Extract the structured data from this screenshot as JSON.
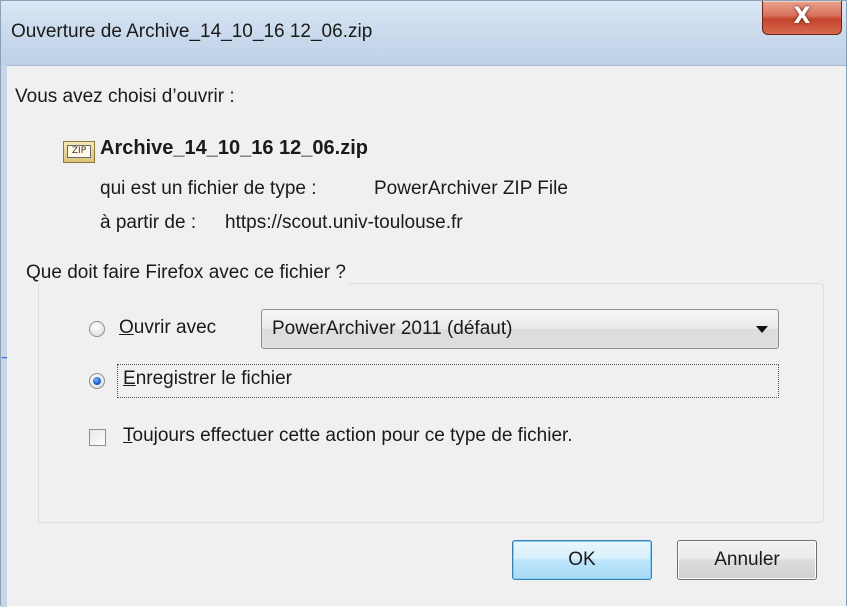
{
  "window": {
    "title": "Ouverture de Archive_14_10_16 12_06.zip",
    "close_label": "X"
  },
  "intro": "Vous avez choisi d’ouvrir :",
  "file": {
    "icon_label": "ZIP",
    "name": "Archive_14_10_16 12_06.zip",
    "type_label": "qui est un fichier de type :",
    "type_value": "PowerArchiver ZIP File",
    "source_label": "à partir de :",
    "source_value": "https://scout.univ-toulouse.fr"
  },
  "group": {
    "title": "Que doit faire Firefox avec ce fichier ?",
    "open_with": {
      "access_key": "O",
      "label_rest": "uvrir avec",
      "checked": false,
      "app": "PowerArchiver 2011 (défaut)"
    },
    "save": {
      "access_key": "E",
      "label_rest": "nregistrer le fichier",
      "checked": true
    },
    "always": {
      "access_key": "T",
      "label_rest": "oujours effectuer cette action pour ce type de fichier.",
      "checked": false
    }
  },
  "buttons": {
    "ok": "OK",
    "cancel": "Annuler"
  },
  "colors": {
    "window_bg": "#f0f0f0",
    "titlebar": "#cddcee",
    "close_button": "#c4452c",
    "ok_border": "#3c7fb1"
  }
}
